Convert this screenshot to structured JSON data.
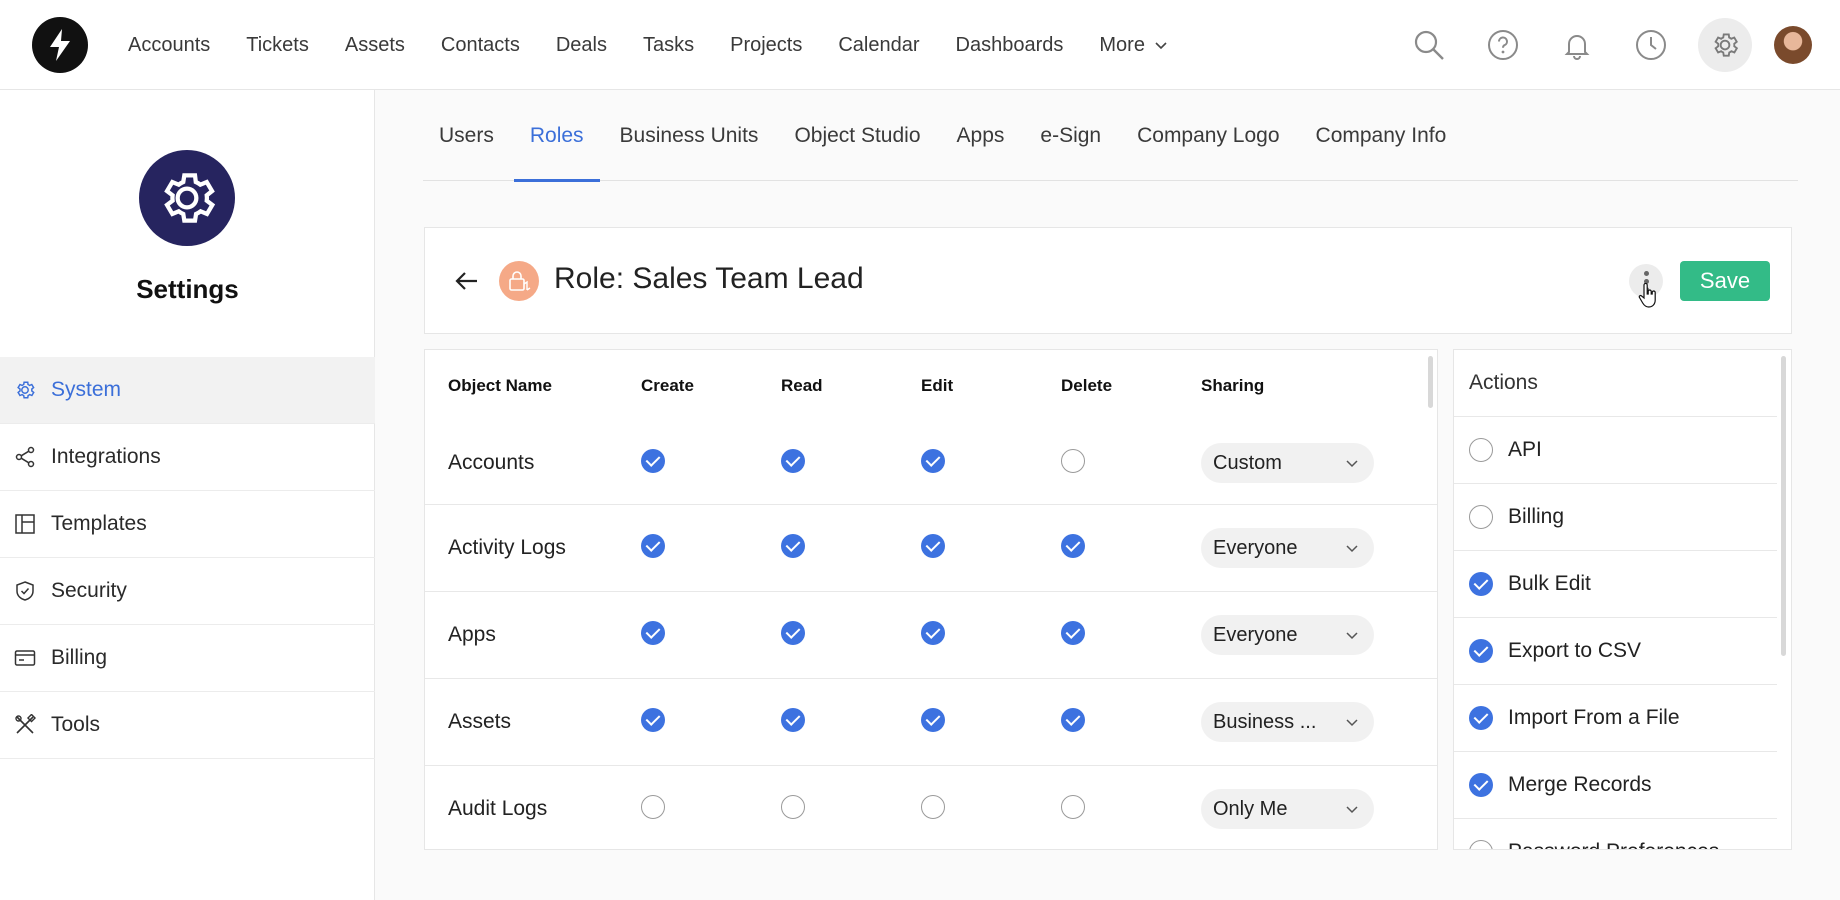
{
  "topnav": {
    "items": [
      "Accounts",
      "Tickets",
      "Assets",
      "Contacts",
      "Deals",
      "Tasks",
      "Projects",
      "Calendar",
      "Dashboards"
    ],
    "more_label": "More"
  },
  "sidebar": {
    "title": "Settings",
    "items": [
      {
        "label": "System",
        "icon": "gear-icon",
        "active": true
      },
      {
        "label": "Integrations",
        "icon": "share-icon"
      },
      {
        "label": "Templates",
        "icon": "layout-icon"
      },
      {
        "label": "Security",
        "icon": "shield-icon"
      },
      {
        "label": "Billing",
        "icon": "card-icon"
      },
      {
        "label": "Tools",
        "icon": "tools-icon"
      }
    ]
  },
  "tabs": [
    "Users",
    "Roles",
    "Business Units",
    "Object Studio",
    "Apps",
    "e-Sign",
    "Company Logo",
    "Company Info"
  ],
  "active_tab": "Roles",
  "role": {
    "title": "Role: Sales Team Lead",
    "save_label": "Save"
  },
  "permissions": {
    "headers": {
      "name": "Object Name",
      "create": "Create",
      "read": "Read",
      "edit": "Edit",
      "delete": "Delete",
      "sharing": "Sharing"
    },
    "rows": [
      {
        "name": "Accounts",
        "create": true,
        "read": true,
        "edit": true,
        "delete": false,
        "sharing": "Custom"
      },
      {
        "name": "Activity Logs",
        "create": true,
        "read": true,
        "edit": true,
        "delete": true,
        "sharing": "Everyone"
      },
      {
        "name": "Apps",
        "create": true,
        "read": true,
        "edit": true,
        "delete": true,
        "sharing": "Everyone"
      },
      {
        "name": "Assets",
        "create": true,
        "read": true,
        "edit": true,
        "delete": true,
        "sharing": "Business ..."
      },
      {
        "name": "Audit Logs",
        "create": false,
        "read": false,
        "edit": false,
        "delete": false,
        "sharing": "Only Me"
      }
    ]
  },
  "actions": {
    "title": "Actions",
    "items": [
      {
        "label": "API",
        "checked": false
      },
      {
        "label": "Billing",
        "checked": false
      },
      {
        "label": "Bulk Edit",
        "checked": true
      },
      {
        "label": "Export to CSV",
        "checked": true
      },
      {
        "label": "Import From a File",
        "checked": true
      },
      {
        "label": "Merge Records",
        "checked": true
      },
      {
        "label": "Password Preferences",
        "checked": false
      }
    ]
  },
  "colors": {
    "accent": "#3d72e0",
    "save": "#33bb87",
    "brand_badge": "#26245f",
    "role_icon": "#f5a987"
  }
}
